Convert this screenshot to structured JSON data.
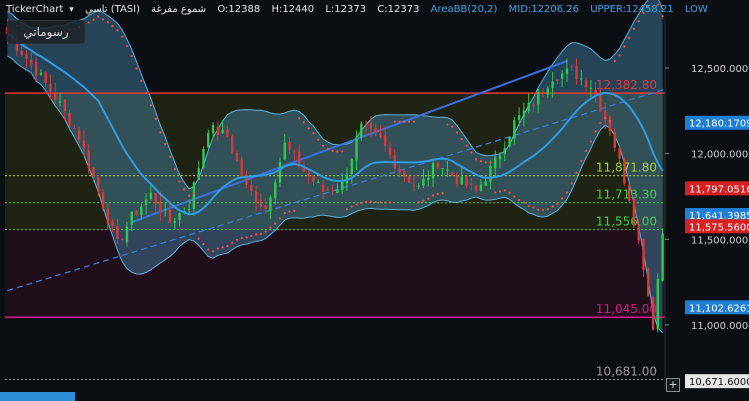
{
  "header": {
    "title": "TickerChart",
    "symbol": "تاسي (TASI)",
    "chart_type": "شموع مفرغة",
    "open": "O:12388",
    "high": "H:12440",
    "low": "L:12373",
    "close": "C:12373",
    "indicator": "AreaBB(20,2)",
    "mid": "MID:12206.26",
    "upper": "UPPER:12458.21",
    "lower": "LOW"
  },
  "watermark": "رسوماتي",
  "colors": {
    "background": "#0b0e13",
    "band_fill": "#4a8fb8",
    "band_edge": "#5eb0dc",
    "mid_line": "#2e9be3",
    "candle_up": "#2fc94f",
    "candle_down": "#d83a3a",
    "psar": "#ff4d4d",
    "trend_line": "#3a6fe0",
    "level_red": "#e53935",
    "level_magenta": "#d01a8c",
    "level_green": "#7fbf2a"
  },
  "chart_data": {
    "type": "candlestick",
    "y_axis_ticks": [
      "12,500.0000",
      "12,000.0000",
      "11,500.0000",
      "11,000.0000"
    ],
    "ylim": [
      10620,
      12780
    ],
    "levels": [
      {
        "value": 12352.8,
        "label": "12,382.80",
        "color": "#e53935"
      },
      {
        "value": 11871.8,
        "label": "11,871.80",
        "color": "#aacd3a"
      },
      {
        "value": 11713.3,
        "label": "11,713.30",
        "color": "#48c94a"
      },
      {
        "value": 11556.0,
        "label": "11,556.00",
        "color": "#48c94a"
      },
      {
        "value": 11045.0,
        "label": "11,045.00",
        "color": "#d01a8c"
      },
      {
        "value": 10681.0,
        "label": "10,681.00",
        "color": "#9a9a9a"
      }
    ],
    "price_badges": [
      {
        "value": 12180.1709,
        "label": "12,180.1709",
        "color": "#1f7fd6"
      },
      {
        "value": 11797.0516,
        "label": "11,797.0516",
        "color": "#d92020"
      },
      {
        "value": 11641.3985,
        "label": "11,641.3985",
        "color": "#1f7fd6"
      },
      {
        "value": 11575.56,
        "label": "11,575.5600",
        "color": "#d92020"
      },
      {
        "value": 11102.6261,
        "label": "11,102.6261",
        "color": "#1f7fd6"
      },
      {
        "value": 10671.6,
        "label": "10,671.6000",
        "color": "#e8e8e8"
      }
    ],
    "series": [
      {
        "name": "MID",
        "type": "line"
      },
      {
        "name": "UPPER",
        "type": "band-edge"
      },
      {
        "name": "LOW",
        "type": "band-edge"
      }
    ],
    "key_points": [
      {
        "i": 0,
        "price": 12700
      },
      {
        "i": 5,
        "price": 12520
      },
      {
        "i": 10,
        "price": 12330
      },
      {
        "i": 15,
        "price": 12100
      },
      {
        "i": 20,
        "price": 11700
      },
      {
        "i": 23,
        "price": 11470
      },
      {
        "i": 26,
        "price": 11630
      },
      {
        "i": 30,
        "price": 11760
      },
      {
        "i": 34,
        "price": 11600
      },
      {
        "i": 38,
        "price": 11700
      },
      {
        "i": 42,
        "price": 12150
      },
      {
        "i": 46,
        "price": 12100
      },
      {
        "i": 50,
        "price": 11800
      },
      {
        "i": 54,
        "price": 11680
      },
      {
        "i": 58,
        "price": 12050
      },
      {
        "i": 62,
        "price": 11900
      },
      {
        "i": 66,
        "price": 11780
      },
      {
        "i": 70,
        "price": 11820
      },
      {
        "i": 74,
        "price": 12150
      },
      {
        "i": 78,
        "price": 12080
      },
      {
        "i": 82,
        "price": 11900
      },
      {
        "i": 86,
        "price": 11800
      },
      {
        "i": 90,
        "price": 11950
      },
      {
        "i": 94,
        "price": 11850
      },
      {
        "i": 98,
        "price": 11780
      },
      {
        "i": 102,
        "price": 11950
      },
      {
        "i": 106,
        "price": 12180
      },
      {
        "i": 110,
        "price": 12300
      },
      {
        "i": 114,
        "price": 12450
      },
      {
        "i": 118,
        "price": 12480
      },
      {
        "i": 122,
        "price": 12400
      },
      {
        "i": 126,
        "price": 12150
      },
      {
        "i": 130,
        "price": 11750
      },
      {
        "i": 133,
        "price": 11350
      },
      {
        "i": 135,
        "price": 11000
      },
      {
        "i": 137,
        "price": 11540
      }
    ],
    "trend_lines": [
      {
        "from": {
          "i": 26,
          "price": 11600
        },
        "to": {
          "i": 117,
          "price": 12540
        }
      },
      {
        "from": {
          "i": 0,
          "price": 11200
        },
        "to": {
          "i": 138,
          "price": 12380
        }
      }
    ],
    "candle_count": 138
  }
}
